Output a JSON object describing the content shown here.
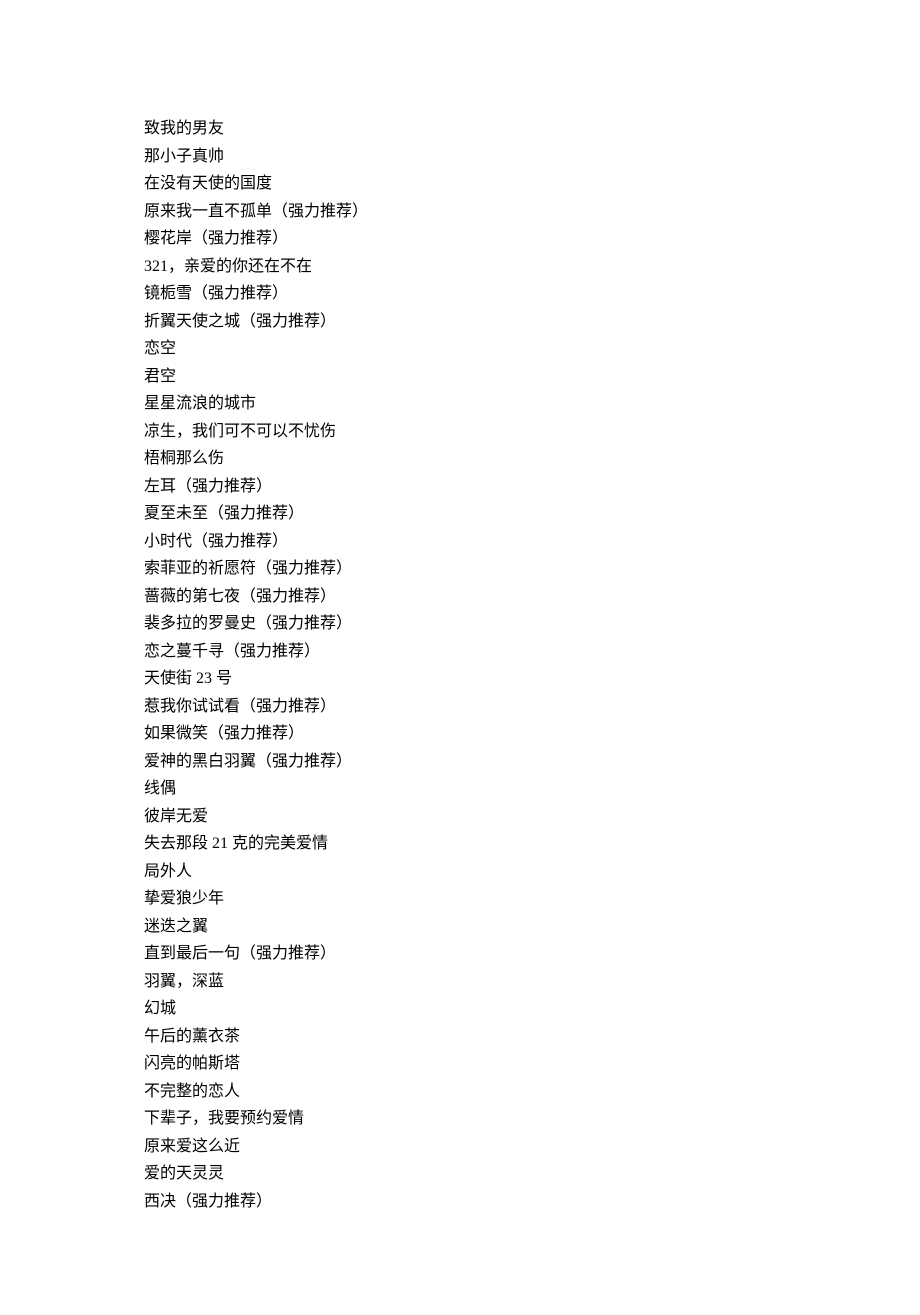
{
  "lines": [
    "致我的男友",
    "那小子真帅",
    "在没有天使的国度",
    "原来我一直不孤单（强力推荐）",
    "樱花岸（强力推荐）",
    "321，亲爱的你还在不在",
    "镜栀雪（强力推荐）",
    "折翼天使之城（强力推荐）",
    "恋空",
    "君空",
    "星星流浪的城市",
    "凉生，我们可不可以不忧伤",
    "梧桐那么伤",
    "左耳（强力推荐）",
    "夏至未至（强力推荐）",
    "小时代（强力推荐）",
    "索菲亚的祈愿符（强力推荐）",
    "蔷薇的第七夜（强力推荐）",
    "裴多拉的罗曼史（强力推荐）",
    "恋之蔓千寻（强力推荐）",
    "天使街 23 号",
    "惹我你试试看（强力推荐）",
    "如果微笑（强力推荐）",
    "爱神的黑白羽翼（强力推荐）",
    "线偶",
    "彼岸无爱",
    "失去那段 21 克的完美爱情",
    "局外人",
    "挚爱狼少年",
    "迷迭之翼",
    "直到最后一句（强力推荐）",
    "羽翼，深蓝",
    "幻城",
    "午后的薰衣茶",
    "闪亮的帕斯塔",
    "不完整的恋人",
    "下辈子，我要预约爱情",
    "原来爱这么近",
    "爱的天灵灵",
    "西决（强力推荐）"
  ]
}
